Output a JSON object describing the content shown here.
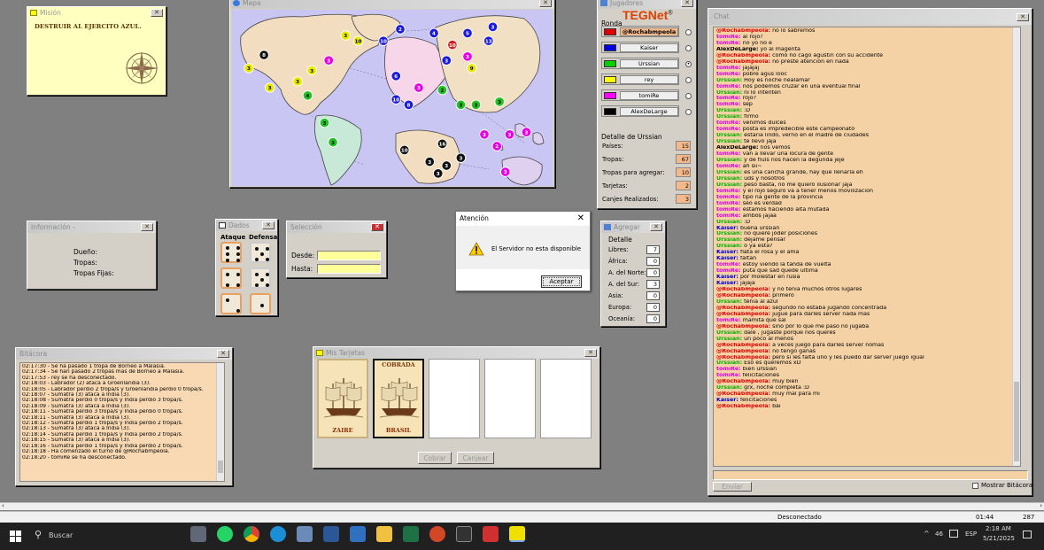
{
  "mision": {
    "title": "Misión",
    "text": "DESTRUIR AL EJERCITO AZUL."
  },
  "mapa": {
    "title": "Mapa",
    "armies": [
      {
        "n": "3",
        "c": "#e8e800",
        "tc": "#000"
      },
      {
        "n": "8",
        "c": "#111",
        "tc": "#fff"
      },
      {
        "n": "3",
        "c": "#e8e800",
        "tc": "#000"
      },
      {
        "n": "3",
        "c": "#e8e800",
        "tc": "#000"
      },
      {
        "n": "3",
        "c": "#e8e800",
        "tc": "#000"
      },
      {
        "n": "3",
        "c": "#e8e800",
        "tc": "#000"
      },
      {
        "n": "10",
        "c": "#e8e800",
        "tc": "#000"
      },
      {
        "n": "4",
        "c": "#22c022",
        "tc": "#000"
      },
      {
        "n": "3",
        "c": "#e800e8",
        "tc": "#fff"
      },
      {
        "n": "10",
        "c": "#1a1adc",
        "tc": "#fff"
      },
      {
        "n": "2",
        "c": "#1a1adc",
        "tc": "#fff"
      },
      {
        "n": "3",
        "c": "#1a1adc",
        "tc": "#fff"
      },
      {
        "n": "10",
        "c": "#cc2020",
        "tc": "#fff"
      },
      {
        "n": "6",
        "c": "#1a1adc",
        "tc": "#fff"
      },
      {
        "n": "3",
        "c": "#e800e8",
        "tc": "#fff"
      },
      {
        "n": "10",
        "c": "#1a1adc",
        "tc": "#fff"
      },
      {
        "n": "8",
        "c": "#1a1adc",
        "tc": "#fff"
      },
      {
        "n": "2",
        "c": "#22c022",
        "tc": "#000"
      },
      {
        "n": "9",
        "c": "#e8e800",
        "tc": "#000"
      },
      {
        "n": "3",
        "c": "#22c022",
        "tc": "#000"
      },
      {
        "n": "3",
        "c": "#22c022",
        "tc": "#000"
      },
      {
        "n": "3",
        "c": "#22c022",
        "tc": "#000"
      },
      {
        "n": "3",
        "c": "#22c022",
        "tc": "#000"
      },
      {
        "n": "3",
        "c": "#22c022",
        "tc": "#000"
      },
      {
        "n": "10",
        "c": "#111",
        "tc": "#fff"
      },
      {
        "n": "16",
        "c": "#111",
        "tc": "#fff"
      },
      {
        "n": "3",
        "c": "#111",
        "tc": "#fff"
      },
      {
        "n": "3",
        "c": "#111",
        "tc": "#fff"
      },
      {
        "n": "3",
        "c": "#111",
        "tc": "#fff"
      },
      {
        "n": "3",
        "c": "#e800e8",
        "tc": "#fff"
      },
      {
        "n": "3",
        "c": "#e800e8",
        "tc": "#fff"
      },
      {
        "n": "3",
        "c": "#e800e8",
        "tc": "#fff"
      },
      {
        "n": "3",
        "c": "#e800e8",
        "tc": "#fff"
      },
      {
        "n": "2",
        "c": "#e800e8",
        "tc": "#fff"
      },
      {
        "n": "13",
        "c": "#1a1adc",
        "tc": "#fff"
      },
      {
        "n": "5",
        "c": "#1a1adc",
        "tc": "#fff"
      },
      {
        "n": "3",
        "c": "#1a1adc",
        "tc": "#fff"
      },
      {
        "n": "3",
        "c": "#111",
        "tc": "#fff"
      },
      {
        "n": "3",
        "c": "#e800e8",
        "tc": "#fff"
      },
      {
        "n": "4",
        "c": "#1a1adc",
        "tc": "#fff"
      }
    ]
  },
  "jugadores": {
    "title": "Jugadores",
    "logo": "TEGNet",
    "logo_mark": "®",
    "ronda_label": "Ronda",
    "players": [
      {
        "name": "@Rochabmpeola",
        "color": "#e00000"
      },
      {
        "name": "Kaiser",
        "color": "#0000e0"
      },
      {
        "name": "Urssian",
        "color": "#00d000"
      },
      {
        "name": "rey",
        "color": "#ffff00"
      },
      {
        "name": "tomiRe",
        "color": "#ff00ff"
      },
      {
        "name": "AlexDeLarge",
        "color": "#000000"
      }
    ],
    "detalle_label": "Detalle de Urssian",
    "stats": [
      {
        "label": "Países:",
        "value": "15"
      },
      {
        "label": "Tropas:",
        "value": "67"
      },
      {
        "label": "Tropas para agregar:",
        "value": "10"
      },
      {
        "label": "Tarjetas:",
        "value": "2"
      },
      {
        "label": "Canjes Realizados:",
        "value": "3"
      }
    ]
  },
  "informacion": {
    "title": "Información -",
    "lines": [
      "Dueño:",
      "Tropas:",
      "Tropas Fijas:"
    ]
  },
  "dados": {
    "title": "Dados",
    "ataque": "Ataque",
    "defensa": "Defensa"
  },
  "seleccion": {
    "title": "Selección",
    "desde": "Desde:",
    "hasta": "Hasta:"
  },
  "atencion": {
    "title": "Atención",
    "message": "El Servidor no esta disponible",
    "ok": "Aceptar"
  },
  "agregar": {
    "title": "Agregar",
    "detalle": "Detalle",
    "rows": [
      {
        "label": "Libres:",
        "value": "7"
      },
      {
        "label": "África:",
        "value": "0"
      },
      {
        "label": "A. del Norte:",
        "value": "0"
      },
      {
        "label": "A. del Sur:",
        "value": "3"
      },
      {
        "label": "Asia:",
        "value": "0"
      },
      {
        "label": "Europa:",
        "value": "0"
      },
      {
        "label": "Oceanía:",
        "value": "0"
      }
    ]
  },
  "bitacora": {
    "title": "Bitácora",
    "lines": [
      "02:17:30 - Se ha pasado 1 tropa de Borneo a Malasia.",
      "02:17:34 - Se han pasado 2 tropas mas de Borneo a Malasia.",
      "02:17:53 - rey se ha desconectado.",
      "02:18:03 - Labrador (2) ataca a Groenlandia (3).",
      "02:18:05 - Labrador perdió 2 tropa/s y Groenlandia perdió 0 tropa/s.",
      "02:18:07 - Sumatra (3) ataca a India (3).",
      "02:18:08 - Sumatra perdió 0 tropa/s y India perdió 3 tropa/s.",
      "02:18:09 - Sumatra (3) ataca a India (3).",
      "02:18:11 - Sumatra perdió 3 tropa/s y India perdió 0 tropa/s.",
      "02:18:11 - Sumatra (3) ataca a India (3).",
      "02:18:12 - Sumatra perdió 1 tropa/s y India perdió 2 tropa/s.",
      "02:18:13 - Sumatra (3) ataca a India (3).",
      "02:18:14 - Sumatra perdió 1 tropa/s y India perdió 2 tropa/s.",
      "02:18:15 - Sumatra (3) ataca a India (3).",
      "02:18:16 - Sumatra perdió 1 tropa/s y India perdió 2 tropa/s.",
      "02:18:18 - Ha comenzado el turno de @Rochabmpeola.",
      "02:18:20 - tomiRe se ha desconectado."
    ]
  },
  "tarjetas": {
    "title": "Mis Tarjetas",
    "cards": [
      {
        "name": "ZAIRE",
        "header": ""
      },
      {
        "name": "BRASIL",
        "header": "COBRADA"
      }
    ],
    "cobrar": "Cobrar",
    "canjear": "Canjear"
  },
  "chat": {
    "title": "Chat",
    "send": "Enviar",
    "mostrar": "Mostrar Bitácora",
    "lines": [
      {
        "u": "@Rochabmpeola:",
        "c": "#e00000",
        "t": "no lo sabremos"
      },
      {
        "u": "tomiRe:",
        "c": "#e000e0",
        "t": "al rojo?"
      },
      {
        "u": "tomiRe:",
        "c": "#e000e0",
        "t": "no yo no e"
      },
      {
        "u": "AlexDeLarge:",
        "c": "#000000",
        "t": "yo al magenta"
      },
      {
        "u": "@Rochabmpeola:",
        "c": "#e00000",
        "t": "como no cago agustin con su accidente"
      },
      {
        "u": "@Rochabmpeola:",
        "c": "#e00000",
        "t": "no preste atencion en nada"
      },
      {
        "u": "tomiRe:",
        "c": "#e000e0",
        "t": "jajajaj"
      },
      {
        "u": "tomiRe:",
        "c": "#e000e0",
        "t": "pobre agus looc"
      },
      {
        "u": "Urssian:",
        "c": "#00b000",
        "t": "Hoy es noche nealamar"
      },
      {
        "u": "tomiRe:",
        "c": "#e000e0",
        "t": "nos podemos cruzar en una eventual final"
      },
      {
        "u": "Urssian:",
        "c": "#00b000",
        "t": "ni lo intenten"
      },
      {
        "u": "tomiRe:",
        "c": "#e000e0",
        "t": "rojo?"
      },
      {
        "u": "tomiRe:",
        "c": "#e000e0",
        "t": "sep"
      },
      {
        "u": "Urssian:",
        "c": "#00b000",
        "t": ":D"
      },
      {
        "u": "Urssian:",
        "c": "#00b000",
        "t": "firmo"
      },
      {
        "u": "tomiRe:",
        "c": "#e000e0",
        "t": "venimos dulces"
      },
      {
        "u": "tomiRe:",
        "c": "#e000e0",
        "t": "posta es impredecible este campeonato"
      },
      {
        "u": "Urssian:",
        "c": "#00b000",
        "t": "estaria lindo, verno en el madre de ciudades"
      },
      {
        "u": "Urssian:",
        "c": "#00b000",
        "t": "te llevo jaja"
      },
      {
        "u": "AlexDeLarge:",
        "c": "#000000",
        "t": "nos vemos"
      },
      {
        "u": "tomiRe:",
        "c": "#e000e0",
        "t": "van a llevar una locura de gente"
      },
      {
        "u": "Urssian:",
        "c": "#00b000",
        "t": "y de fiuls nos hacen la degunda jeje"
      },
      {
        "u": "tomiRe:",
        "c": "#e000e0",
        "t": "ah sii~"
      },
      {
        "u": "Urssian:",
        "c": "#00b000",
        "t": "es una cancha grande, hay que llenarla eh"
      },
      {
        "u": "Urssian:",
        "c": "#00b000",
        "t": "uds y nosotros"
      },
      {
        "u": "Urssian:",
        "c": "#00b000",
        "t": "peso basta, no me quiero ilusionar jaja"
      },
      {
        "u": "tomiRe:",
        "c": "#e000e0",
        "t": "y el rojo seguro va a tener menos movilizacion"
      },
      {
        "u": "tomiRe:",
        "c": "#e000e0",
        "t": "tipo na gente de la provincia"
      },
      {
        "u": "tomiRe:",
        "c": "#e000e0",
        "t": "seo es verdad"
      },
      {
        "u": "tomiRe:",
        "c": "#e000e0",
        "t": "estamos haciendo alta mutada"
      },
      {
        "u": "tomiRe:",
        "c": "#e000e0",
        "t": "ambos jajaa"
      },
      {
        "u": "Urssian:",
        "c": "#00b000",
        "t": ":D"
      },
      {
        "u": "Kaiser:",
        "c": "#0000d0",
        "t": "buena urssian"
      },
      {
        "u": "Urssian:",
        "c": "#00b000",
        "t": "no quiere joder posiciones"
      },
      {
        "u": "Urssian:",
        "c": "#00b000",
        "t": "dejame pensar"
      },
      {
        "u": "Urssian:",
        "c": "#00b000",
        "t": "o ya esta?"
      },
      {
        "u": "Kaiser:",
        "c": "#0000d0",
        "t": "flata el rosa y el ama"
      },
      {
        "u": "Kaiser:",
        "c": "#0000d0",
        "t": "faltan"
      },
      {
        "u": "tomiRe:",
        "c": "#e000e0",
        "t": "estoy viendo la tanda de vuelta"
      },
      {
        "u": "tomiRe:",
        "c": "#e000e0",
        "t": "puta que sad quede ultima"
      },
      {
        "u": "Kaiser:",
        "c": "#0000d0",
        "t": "por molestar en rusia"
      },
      {
        "u": "Kaiser:",
        "c": "#0000d0",
        "t": "jajaja"
      },
      {
        "u": "@Rochabmpeola:",
        "c": "#e00000",
        "t": "y no tenia muchos otros lugares"
      },
      {
        "u": "@Rochabmpeola:",
        "c": "#e00000",
        "t": "primero"
      },
      {
        "u": "Urssian:",
        "c": "#00b000",
        "t": "tenia al azul"
      },
      {
        "u": "@Rochabmpeola:",
        "c": "#e00000",
        "t": "segundo no estaba jugando concentrada"
      },
      {
        "u": "@Rochabmpeola:",
        "c": "#e00000",
        "t": "jugue para darles server nada mas"
      },
      {
        "u": "tomiRe:",
        "c": "#e000e0",
        "t": "mamita que sal"
      },
      {
        "u": "@Rochabmpeola:",
        "c": "#e00000",
        "t": "sino por lo que me paso no jugaba"
      },
      {
        "u": "Urssian:",
        "c": "#00b000",
        "t": "dale , jugaste porque nos queres"
      },
      {
        "u": "Urssian:",
        "c": "#00b000",
        "t": "un poco al menos"
      },
      {
        "u": "@Rochabmpeola:",
        "c": "#e00000",
        "t": "a veces juego para darles server nomas"
      },
      {
        "u": "@Rochabmpeola:",
        "c": "#e00000",
        "t": "no tengo ganas"
      },
      {
        "u": "@Rochabmpeola:",
        "c": "#e00000",
        "t": "pero si les falta uno y les puedo dar server juego igual"
      },
      {
        "u": "Urssian:",
        "c": "#00b000",
        "t": "Eso es queremos xD"
      },
      {
        "u": "tomiRe:",
        "c": "#e000e0",
        "t": "bien urssian"
      },
      {
        "u": "tomiRe:",
        "c": "#e000e0",
        "t": "felicitaciones"
      },
      {
        "u": "@Rochabmpeola:",
        "c": "#e00000",
        "t": "muy bien"
      },
      {
        "u": "Urssian:",
        "c": "#00b000",
        "t": "grx, noche completa :D"
      },
      {
        "u": "@Rochabmpeola:",
        "c": "#e00000",
        "t": "muy mal para mi"
      },
      {
        "u": "Kaiser:",
        "c": "#0000d0",
        "t": "felicitaciones"
      },
      {
        "u": "@Rochabmpeola:",
        "c": "#e00000",
        "t": "bai"
      }
    ]
  },
  "status": {
    "center": "Desconectado",
    "time": "01:44",
    "count": "287"
  },
  "taskbar": {
    "search": "Buscar",
    "weather": "46",
    "lang": "ESP",
    "time": "2:18 AM",
    "date": "5/21/2025"
  },
  "colors": {
    "orange": "#f5d2a6",
    "yellow_note": "#ffffc0",
    "peach": "#f3b98a"
  }
}
